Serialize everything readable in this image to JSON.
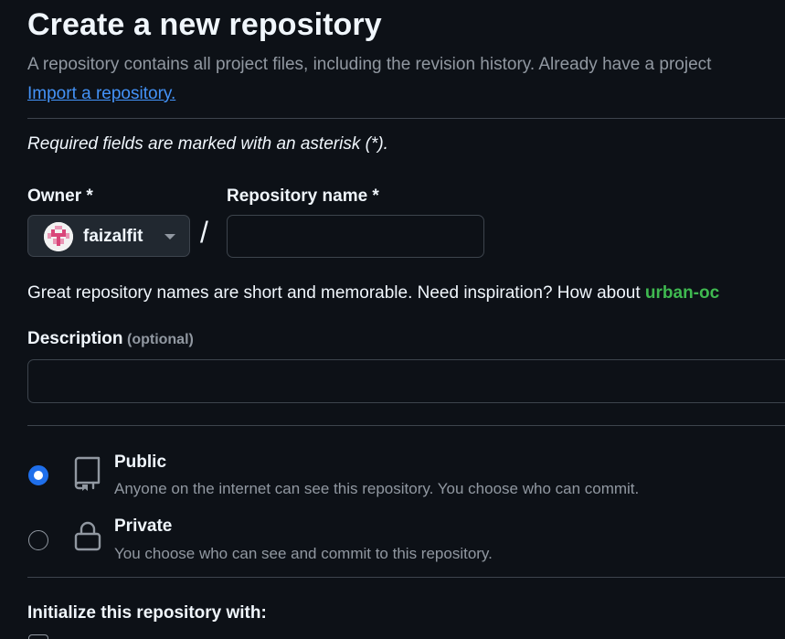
{
  "header": {
    "title": "Create a new repository",
    "subtitle": "A repository contains all project files, including the revision history. Already have a project",
    "import_link": "Import a repository."
  },
  "form": {
    "required_note": "Required fields are marked with an asterisk (*).",
    "owner": {
      "label": "Owner *",
      "selected": "faizalfit",
      "avatar_icon": "identicon-avatar"
    },
    "separator": "/",
    "repo_name": {
      "label": "Repository name *",
      "value": "",
      "placeholder": ""
    },
    "name_hint": {
      "text": "Great repository names are short and memorable. Need inspiration? How about ",
      "suggestion": "urban-oc"
    },
    "description": {
      "label": "Description",
      "optional": "(optional)",
      "value": "",
      "placeholder": ""
    },
    "visibility": [
      {
        "title": "Public",
        "description": "Anyone on the internet can see this repository. You choose who can commit.",
        "selected": true,
        "icon": "repo-book-icon"
      },
      {
        "title": "Private",
        "description": "You choose who can see and commit to this repository.",
        "selected": false,
        "icon": "lock-icon"
      }
    ],
    "initialize_label": "Initialize this repository with:"
  },
  "colors": {
    "background": "#0d1117",
    "link": "#4493f8",
    "suggestion": "#3fb950",
    "radio_selected": "#1f6feb",
    "muted_text": "#9198a1",
    "border": "#3d444d"
  }
}
